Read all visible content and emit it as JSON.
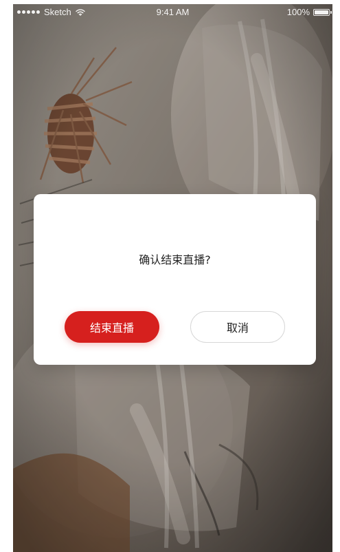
{
  "status_bar": {
    "carrier": "Sketch",
    "time": "9:41 AM",
    "battery": "100%"
  },
  "dialog": {
    "title": "确认结束直播?",
    "confirm_label": "结束直播",
    "cancel_label": "取消"
  },
  "colors": {
    "accent": "#D6201E"
  }
}
